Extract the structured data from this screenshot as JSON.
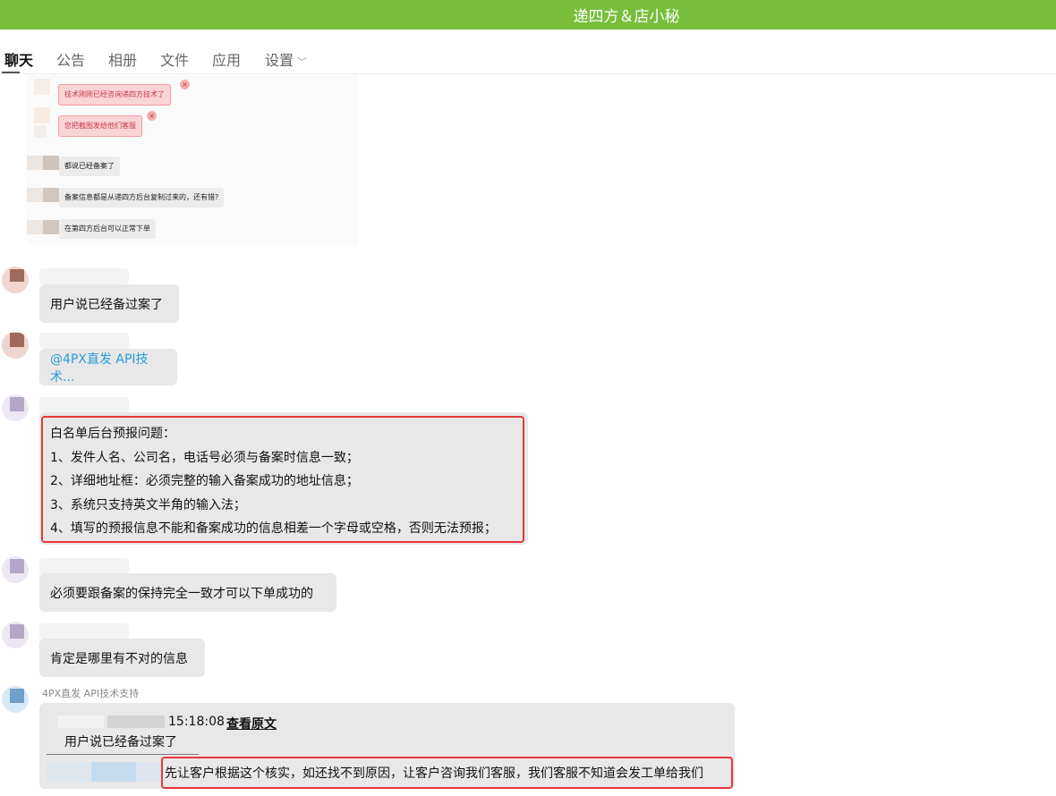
{
  "window": {
    "title": "递四方＆店小秘"
  },
  "tabs": [
    {
      "label": "聊天",
      "active": true
    },
    {
      "label": "公告"
    },
    {
      "label": "相册"
    },
    {
      "label": "文件"
    },
    {
      "label": "应用"
    },
    {
      "label": "设置"
    }
  ],
  "embedded_screenshot": {
    "pink_messages": [
      "技术刚刚已经咨询递四方技术了",
      "您把截图发给他们客服"
    ],
    "grey_messages": [
      "都说已经备案了",
      "备案信息都是从递四方后台复制过来的，还有错?",
      "在第四方后台可以正常下单"
    ]
  },
  "messages": {
    "m1": "用户说已经备过案了",
    "m2": "@4PX直发 API技术...",
    "rules_title": "白名单后台预报问题：",
    "rules": [
      "1、发件人名、公司名，电话号必须与备案时信息一致；",
      "2、详细地址框：必须完整的输入备案成功的地址信息；",
      "3、系统只支持英文半角的输入法；",
      "4、填写的预报信息不能和备案成功的信息相差一个字母或空格，否则无法预报；"
    ],
    "m4": "必须要跟备案的保持完全一致才可以下单成功的",
    "m5": "肯定是哪里有不对的信息",
    "sender": "4PX直发 API技术支持",
    "quote_time": "15:18:08",
    "quote_view": "查看原文",
    "quote_text": "用户说已经备过案了",
    "reply": "先让客户根据这个核实，如还找不到原因，让客户咨询我们客服，我们客服不知道会发工单给我们"
  },
  "colors": {
    "titlebar": "#78be3b",
    "highlight_red": "#e8363b",
    "link": "#2a9bd8",
    "bubble": "#e8e8e8"
  }
}
